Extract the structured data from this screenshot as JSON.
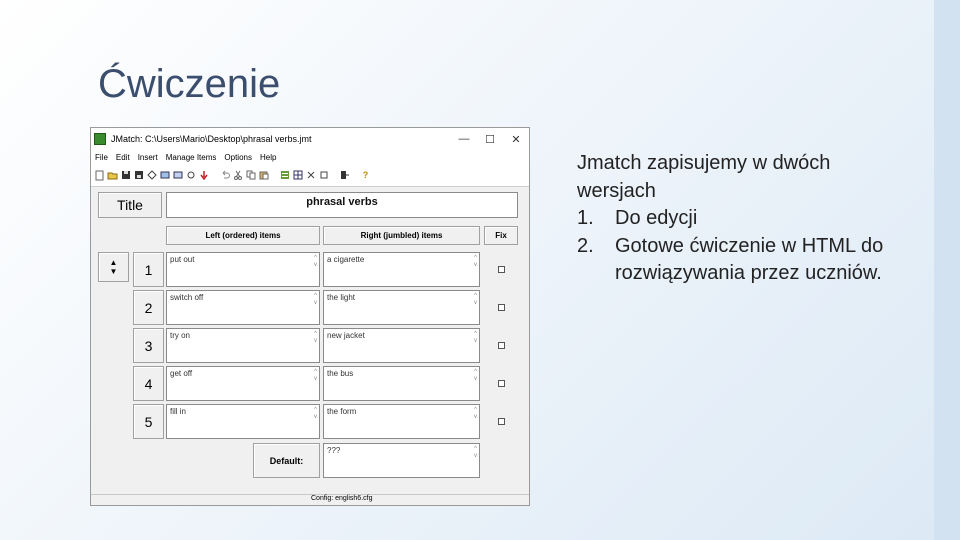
{
  "slide": {
    "title": "Ćwiczenie",
    "intro": "Jmatch zapisujemy w dwóch wersjach",
    "items": [
      {
        "number": "1.",
        "text": "Do edycji"
      },
      {
        "number": "2.",
        "text": "Gotowe ćwiczenie w HTML do rozwiązywania przez uczniów."
      }
    ]
  },
  "window": {
    "title": "JMatch: C:\\Users\\Mario\\Desktop\\phrasal verbs.jmt",
    "minimize": "—",
    "maximize": "☐",
    "close": "✕",
    "menu": [
      "File",
      "Edit",
      "Insert",
      "Manage Items",
      "Options",
      "Help"
    ],
    "title_button": "Title",
    "title_value": "phrasal verbs",
    "col_left": "Left (ordered) items",
    "col_right": "Right (jumbled) items",
    "col_fix": "Fix",
    "rows": [
      {
        "num": "1",
        "left": "put out",
        "right": "a cigarette"
      },
      {
        "num": "2",
        "left": "switch off",
        "right": "the light"
      },
      {
        "num": "3",
        "left": "try on",
        "right": "new jacket"
      },
      {
        "num": "4",
        "left": "get off",
        "right": "the bus"
      },
      {
        "num": "5",
        "left": "fill in",
        "right": "the form"
      }
    ],
    "default_label": "Default:",
    "default_value": "???",
    "status": "Config: english6.cfg"
  },
  "icons": [
    "app-icon",
    "new-file-icon",
    "open-folder-icon",
    "save-icon",
    "save-as-icon",
    "html-export-icon",
    "undo-icon",
    "cut-icon",
    "copy-icon",
    "paste-icon",
    "help-icon"
  ]
}
